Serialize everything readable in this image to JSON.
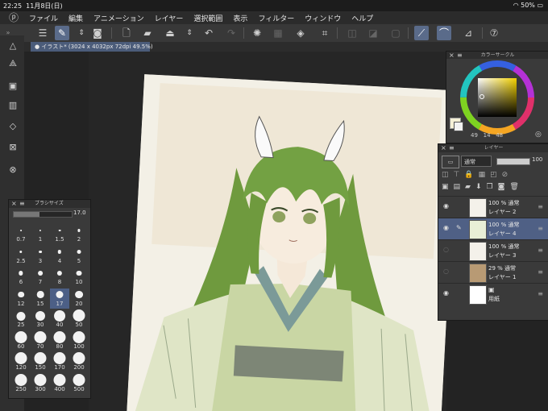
{
  "status_bar": {
    "time": "22:25",
    "date": "11月8日(日)",
    "battery": "50%"
  },
  "menu": {
    "items": [
      "ファイル",
      "編集",
      "アニメーション",
      "レイヤー",
      "選択範囲",
      "表示",
      "フィルター",
      "ウィンドウ",
      "ヘルプ"
    ]
  },
  "document": {
    "tab_title": "イラスト* (3024 x 4032px 72dpi 49.5%)"
  },
  "brush_panel": {
    "title": "ブラシサイズ",
    "current_value": "17.0",
    "slider_fraction": 0.45,
    "sizes": [
      "0.7",
      "1",
      "1.5",
      "2",
      "2.5",
      "3",
      "4",
      "5",
      "6",
      "7",
      "8",
      "10",
      "12",
      "15",
      "17",
      "20",
      "25",
      "30",
      "40",
      "50",
      "60",
      "70",
      "80",
      "100",
      "120",
      "150",
      "170",
      "200",
      "250",
      "300",
      "400",
      "500"
    ],
    "selected": "17"
  },
  "color_panel": {
    "title": "カラーサークル",
    "current_color": "#f5f0d6",
    "hue_color": "#f2d100",
    "readout": [
      "49",
      "14",
      "48"
    ]
  },
  "layer_panel": {
    "title": "レイヤー",
    "blend_mode": "通常",
    "opacity": "100",
    "layers": [
      {
        "mode": "100 % 通常",
        "name": "レイヤー 2",
        "selected": false
      },
      {
        "mode": "100 % 通常",
        "name": "レイヤー 4",
        "selected": true
      },
      {
        "mode": "100 % 通常",
        "name": "レイヤー 3",
        "selected": false
      },
      {
        "mode": "29 % 通常",
        "name": "レイヤー 1",
        "selected": false
      },
      {
        "mode": "",
        "name": "用紙",
        "selected": false
      }
    ]
  },
  "colors": {
    "accent": "#4f6085",
    "hair": "#6f9a3e",
    "kimono": "#c7d3a4",
    "collar": "#7b9a98"
  }
}
